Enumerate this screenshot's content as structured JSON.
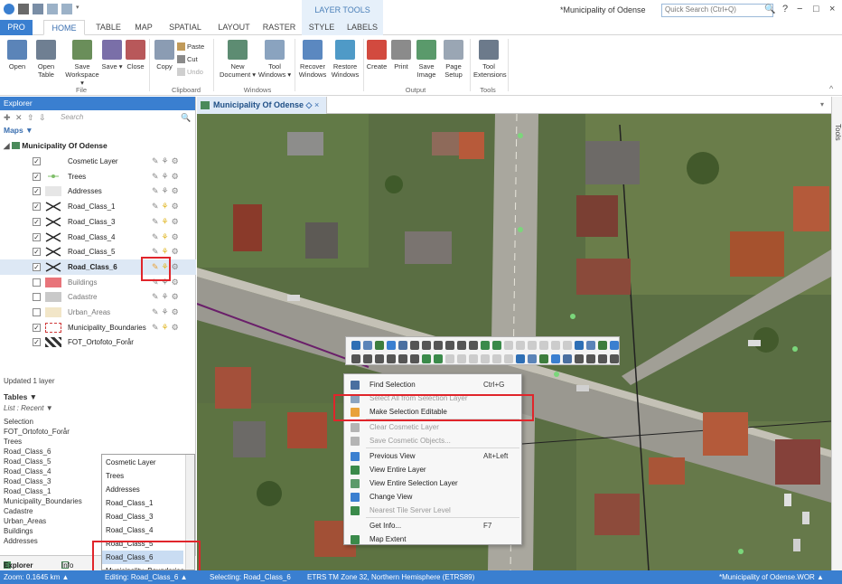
{
  "title_bar": {
    "document_title": "*Municipality of Odense",
    "quick_search_placeholder": "Quick Search (Ctrl+Q)",
    "help": "?",
    "minimize": "−",
    "maximize": "□",
    "close": "×"
  },
  "ribbon_tabs": {
    "pro": "PRO",
    "home": "HOME",
    "table": "TABLE",
    "map": "MAP",
    "spatial": "SPATIAL",
    "layout": "LAYOUT",
    "raster": "RASTER",
    "layer_tools_header": "LAYER TOOLS",
    "style": "STYLE",
    "labels": "LABELS"
  },
  "ribbon": {
    "file": {
      "open": "Open",
      "open_table": "Open Table",
      "save_workspace": "Save Workspace ▾",
      "save": "Save ▾",
      "close": "Close",
      "label": "File"
    },
    "clipboard": {
      "copy": "Copy",
      "paste": "Paste",
      "cut": "Cut",
      "undo": "Undo",
      "label": "Clipboard"
    },
    "windows": {
      "new_document": "New Document ▾",
      "tool_windows": "Tool Windows ▾",
      "recover_windows": "Recover Windows",
      "restore_windows": "Restore Windows",
      "label": "Windows"
    },
    "output": {
      "create": "Create",
      "print": "Print",
      "save_image": "Save Image",
      "page_setup": "Page Setup",
      "label": "Output"
    },
    "tools": {
      "tool_extensions": "Tool Extensions",
      "label": "Tools"
    }
  },
  "explorer": {
    "header": "Explorer",
    "search_placeholder": "Search",
    "maps_label": "Maps ▼",
    "map_name": "Municipality Of Odense",
    "layers": [
      {
        "name": "Cosmetic Layer",
        "checked": "✓"
      },
      {
        "name": "Trees",
        "checked": "✓"
      },
      {
        "name": "Addresses",
        "checked": "✓"
      },
      {
        "name": "Road_Class_1",
        "checked": "✓"
      },
      {
        "name": "Road_Class_3",
        "checked": "✓"
      },
      {
        "name": "Road_Class_4",
        "checked": "✓"
      },
      {
        "name": "Road_Class_5",
        "checked": "✓"
      },
      {
        "name": "Road_Class_6",
        "checked": "✓"
      },
      {
        "name": "Buildings",
        "checked": ""
      },
      {
        "name": "Cadastre",
        "checked": ""
      },
      {
        "name": "Urban_Areas",
        "checked": ""
      },
      {
        "name": "Municipality_Boundaries",
        "checked": "✓"
      },
      {
        "name": "FOT_Ortofoto_Forår",
        "checked": "✓"
      }
    ],
    "updated_text": "Updated 1 layer",
    "tables_label": "Tables ▼",
    "list_recent": "List : Recent ▼",
    "tables": [
      "Selection",
      "FOT_Ortofoto_Forår",
      "Trees",
      "Road_Class_6",
      "Road_Class_5",
      "Road_Class_4",
      "Road_Class_3",
      "Road_Class_1",
      "Municipality_Boundaries",
      "Cadastre",
      "Urban_Areas",
      "Buildings",
      "Addresses"
    ],
    "bottom_tabs": {
      "explorer": "Explorer",
      "info": "Info"
    }
  },
  "dropdown": {
    "items": [
      "Cosmetic Layer",
      "Trees",
      "Addresses",
      "Road_Class_1",
      "Road_Class_3",
      "Road_Class_4",
      "Road_Class_5",
      "Road_Class_6",
      "Municipality_Boundaries"
    ],
    "selected": "Road_Class_6"
  },
  "map_window": {
    "tab_title": "Municipality Of Odense",
    "tools_label": "Tools"
  },
  "context_menu": {
    "items": [
      {
        "label": "Find Selection",
        "shortcut": "Ctrl+G"
      },
      {
        "label": "Select All from Selection Layer",
        "shortcut": ""
      },
      {
        "label": "Make Selection Editable",
        "shortcut": ""
      },
      {
        "label": "Clear Cosmetic Layer",
        "shortcut": ""
      },
      {
        "label": "Save Cosmetic Objects...",
        "shortcut": ""
      },
      {
        "label": "Previous View",
        "shortcut": "Alt+Left"
      },
      {
        "label": "View Entire Layer",
        "shortcut": ""
      },
      {
        "label": "View Entire Selection Layer",
        "shortcut": ""
      },
      {
        "label": "Change View",
        "shortcut": ""
      },
      {
        "label": "Nearest Tile Server Level",
        "shortcut": ""
      },
      {
        "label": "Get Info...",
        "shortcut": "F7"
      },
      {
        "label": "Map Extent",
        "shortcut": ""
      }
    ]
  },
  "status_bar": {
    "zoom": "Zoom: 0.1645 km ▲",
    "editing": "Editing: Road_Class_6 ▲",
    "selecting": "Selecting: Road_Class_6",
    "projection": "ETRS TM Zone 32, Northern Hemisphere (ETRS89)",
    "workspace": "*Municipality of Odense.WOR ▲"
  },
  "colors": {
    "accent_blue": "#3a7fd0",
    "highlight_red": "#e0252b",
    "context_tab_bg": "#e6f0fa"
  }
}
